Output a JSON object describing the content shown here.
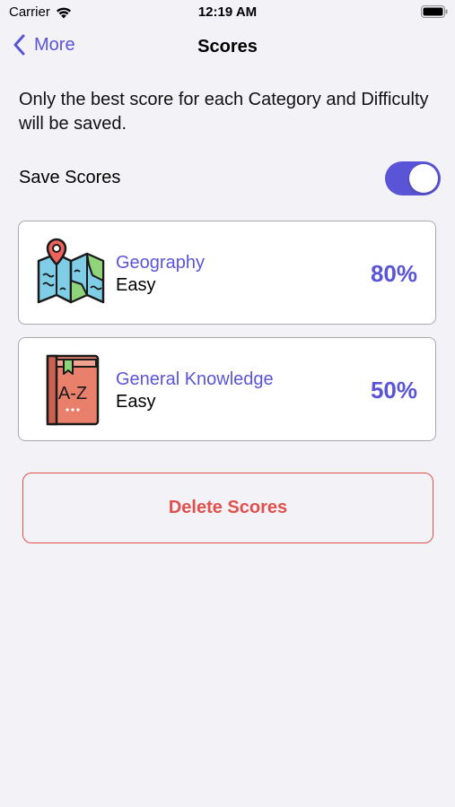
{
  "status_bar": {
    "carrier": "Carrier",
    "time": "12:19 AM"
  },
  "nav": {
    "back_label": "More",
    "title": "Scores"
  },
  "info": "Only the best score for each Category and Difficulty will be saved.",
  "save_scores": {
    "label": "Save Scores",
    "enabled": true
  },
  "scores": [
    {
      "category": "Geography",
      "difficulty": "Easy",
      "score": "80%",
      "icon": "map-icon"
    },
    {
      "category": "General Knowledge",
      "difficulty": "Easy",
      "score": "50%",
      "icon": "book-icon"
    }
  ],
  "icon_text": {
    "book_letters": "A-Z"
  },
  "delete_button": "Delete Scores",
  "colors": {
    "accent": "#5a55d6",
    "destructive": "#e0514d",
    "background": "#f2f2f7"
  }
}
